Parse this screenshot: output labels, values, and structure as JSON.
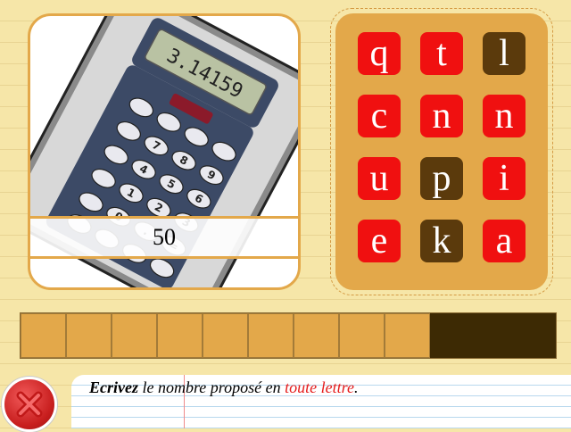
{
  "question": {
    "display_readout": "3.14159",
    "number": "50"
  },
  "letters": [
    {
      "char": "q",
      "state": "red"
    },
    {
      "char": "t",
      "state": "red"
    },
    {
      "char": "l",
      "state": "brown"
    },
    {
      "char": "c",
      "state": "red"
    },
    {
      "char": "n",
      "state": "red"
    },
    {
      "char": "n",
      "state": "red"
    },
    {
      "char": "u",
      "state": "red"
    },
    {
      "char": "p",
      "state": "brown"
    },
    {
      "char": "i",
      "state": "red"
    },
    {
      "char": "e",
      "state": "red"
    },
    {
      "char": "k",
      "state": "brown"
    },
    {
      "char": "a",
      "state": "red"
    }
  ],
  "answer": {
    "filled_slots": 9,
    "slot_values": [
      "",
      "",
      "",
      "",
      "",
      "",
      "",
      "",
      ""
    ]
  },
  "instruction": {
    "part1": "Ecrivez",
    "part2": " le nombre proposé en ",
    "part3": "toute lettre",
    "part4": "."
  },
  "colors": {
    "tile_red": "#f01010",
    "tile_brown": "#5b3a0c",
    "panel": "#e3a84a",
    "slot_empty": "#3d2a04"
  },
  "icons": {
    "close": "close-icon"
  }
}
